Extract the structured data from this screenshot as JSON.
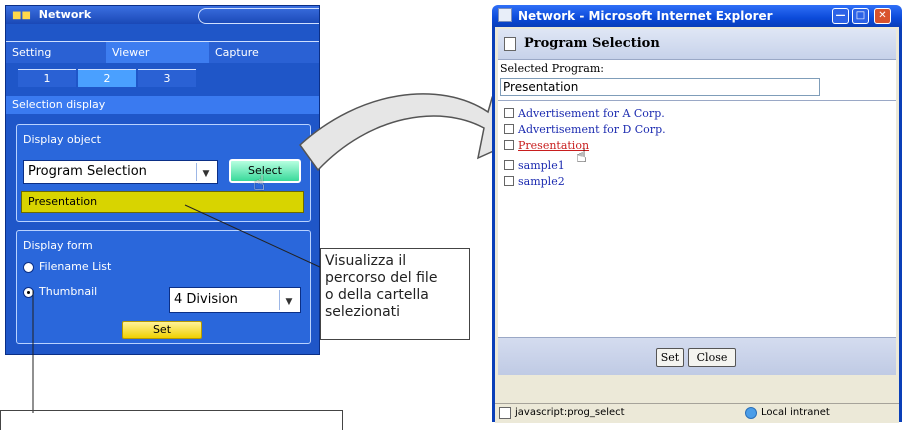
{
  "left_panel": {
    "title": "Network",
    "tabs": [
      "Setting",
      "Viewer",
      "Capture"
    ],
    "subtabs": [
      "1",
      "2",
      "3"
    ],
    "section_title": "Selection display",
    "display_object": {
      "label": "Display object",
      "select_value": "Program Selection",
      "select_button": "Select",
      "path_value": "Presentation"
    },
    "display_form": {
      "label": "Display form",
      "option_filename": "Filename List",
      "option_thumbnail": "Thumbnail",
      "division_value": "4 Division",
      "set_button": "Set"
    }
  },
  "annotation": {
    "text_lines": [
      "Visualizza il",
      "percorso del file",
      "o della cartella",
      "selezionati"
    ]
  },
  "ie_window": {
    "title": "Network - Microsoft Internet Explorer",
    "heading": "Program Selection",
    "selected_label": "Selected Program:",
    "selected_value": "Presentation",
    "items": [
      "Advertisement for A Corp.",
      "Advertisement for D Corp.",
      "Presentation",
      "sample1",
      "sample2"
    ],
    "buttons": {
      "set": "Set",
      "close": "Close"
    },
    "status_left": "javascript:prog_select",
    "status_right": "Local intranet"
  },
  "colors": {
    "panel_blue": "#1f56c8",
    "select_button_green": "#39d99a",
    "path_yellow": "#d8d400",
    "xp_title_blue": "#0b4ad9",
    "link_blue": "#1c2bb0",
    "active_link_red": "#c81e1e"
  },
  "icons": [
    "grid-dots-icon",
    "dropdown-arrow-icon",
    "hand-cursor-icon",
    "ie-page-icon",
    "minimize-icon",
    "maximize-icon",
    "close-icon",
    "tree-node-icon",
    "globe-intranet-icon"
  ]
}
